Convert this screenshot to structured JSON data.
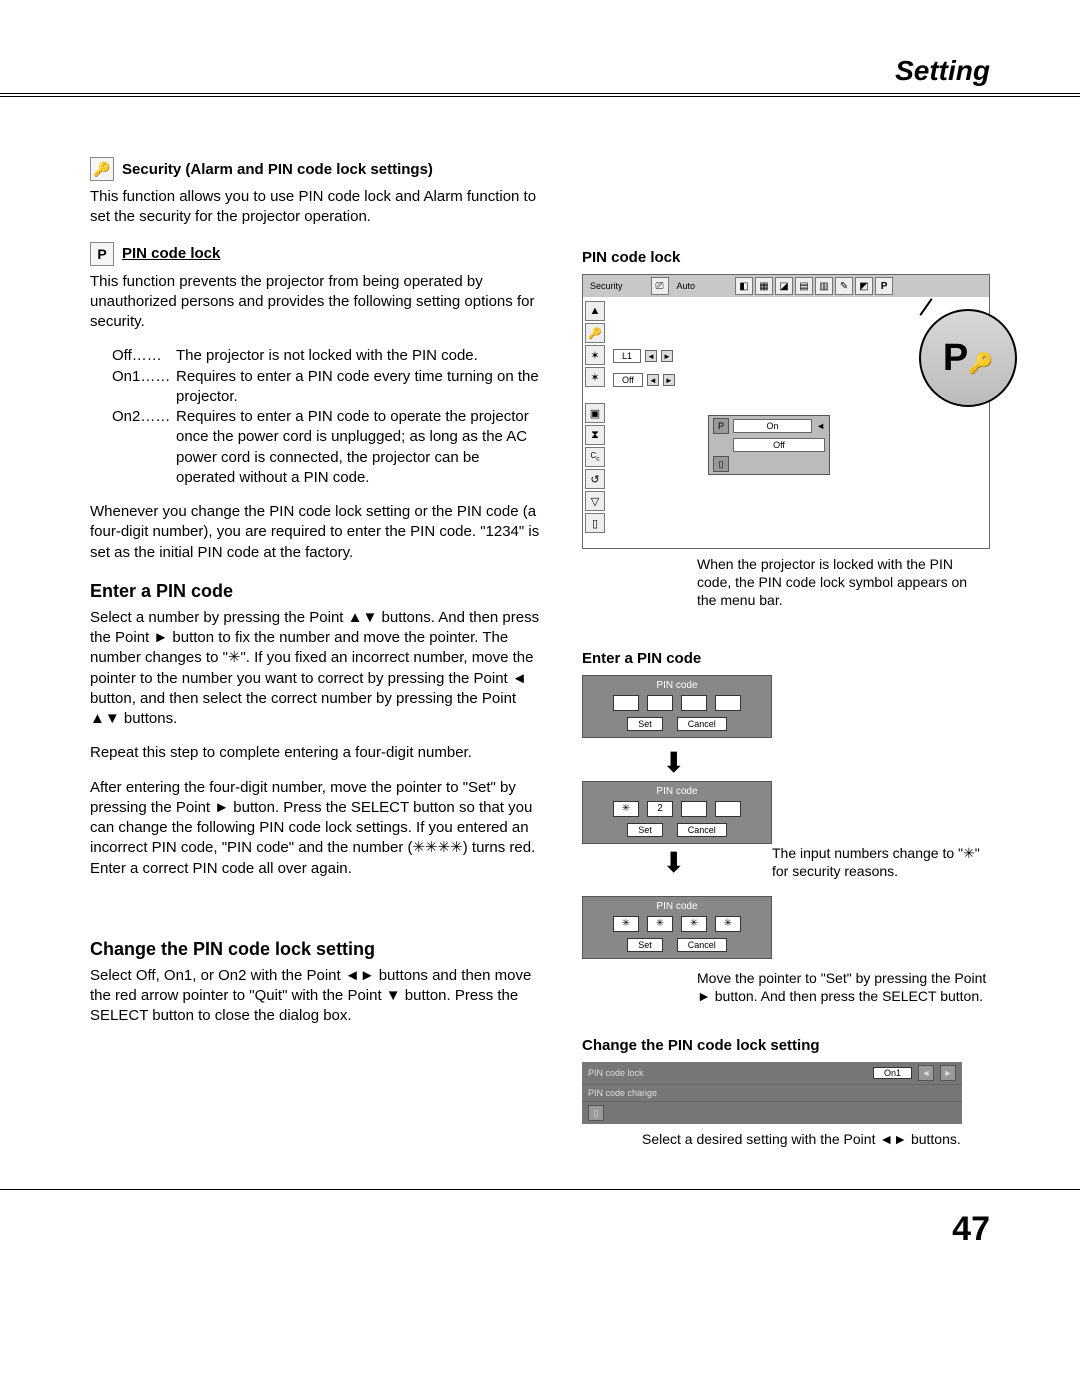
{
  "header": {
    "title": "Setting"
  },
  "page_number": "47",
  "left": {
    "sec1_title": "Security (Alarm and PIN code lock settings)",
    "sec1_body": "This function allows you to use PIN code lock and Alarm function to set the security for the projector operation.",
    "sec2_title": "PIN code lock",
    "sec2_body": "This function prevents the projector from being operated by unauthorized persons and provides the following setting options for security.",
    "opt_off_lbl": "Off……",
    "opt_off_txt": "The projector is not locked with the PIN code.",
    "opt_on1_lbl": "On1……",
    "opt_on1_txt": "Requires to enter a PIN code every time turning on the projector.",
    "opt_on2_lbl": "On2……",
    "opt_on2_txt": "Requires to enter a PIN code to operate the projector once the power cord is unplugged; as long as the AC power cord is connected, the projector can be operated without a PIN code.",
    "sec2_note": "Whenever you change the PIN code lock setting or the PIN code (a four-digit number), you are required to enter the PIN code. \"1234\" is set as the initial PIN code at the factory.",
    "h2_enter": "Enter a PIN code",
    "enter_p1": "Select a number by pressing the Point ▲▼ buttons. And then press the Point ► button to fix the number and move the pointer. The number changes to \"✳\". If you fixed an incorrect number, move the pointer to the number you want to correct by pressing the Point ◄ button, and then select the correct number by pressing the Point ▲▼ buttons.",
    "enter_p2": "Repeat this step to complete entering a four-digit number.",
    "enter_p3": "After entering the four-digit number, move the pointer to \"Set\" by pressing the Point ► button. Press the SELECT button so that you can change the following PIN code lock settings. If you entered an incorrect PIN code, \"PIN code\" and the number (✳✳✳✳) turns red. Enter a correct PIN code all over again.",
    "h2_change": "Change the PIN code lock setting",
    "change_p1": "Select Off, On1, or On2 with the Point ◄► buttons and then move the red arrow pointer to \"Quit\" with the Point ▼ button. Press the SELECT button to close the dialog box."
  },
  "right": {
    "h3_lock": "PIN code lock",
    "menu_security": "Security",
    "menu_auto": "Auto",
    "row_l1": "L1",
    "row_off": "Off",
    "sub_on": "On",
    "sub_off": "Off",
    "circle_label": "P",
    "caption1": "When the projector is locked with the PIN code, the PIN code lock symbol appears on the menu bar.",
    "h3_enter": "Enter a PIN code",
    "pin_title": "PIN code",
    "pin_set": "Set",
    "pin_cancel": "Cancel",
    "pin_val_2": "2",
    "pin_star": "✳",
    "caption2": "The input numbers change to \"✳\" for security reasons.",
    "caption3": "Move the pointer to \"Set\" by pressing the Point ► button. And then press the SELECT button.",
    "h3_change": "Change the PIN code lock setting",
    "fc_lock_lbl": "PIN code lock",
    "fc_lock_val": "On1",
    "fc_change_lbl": "PIN code change",
    "caption4": "Select a desired setting with the Point ◄► buttons."
  }
}
